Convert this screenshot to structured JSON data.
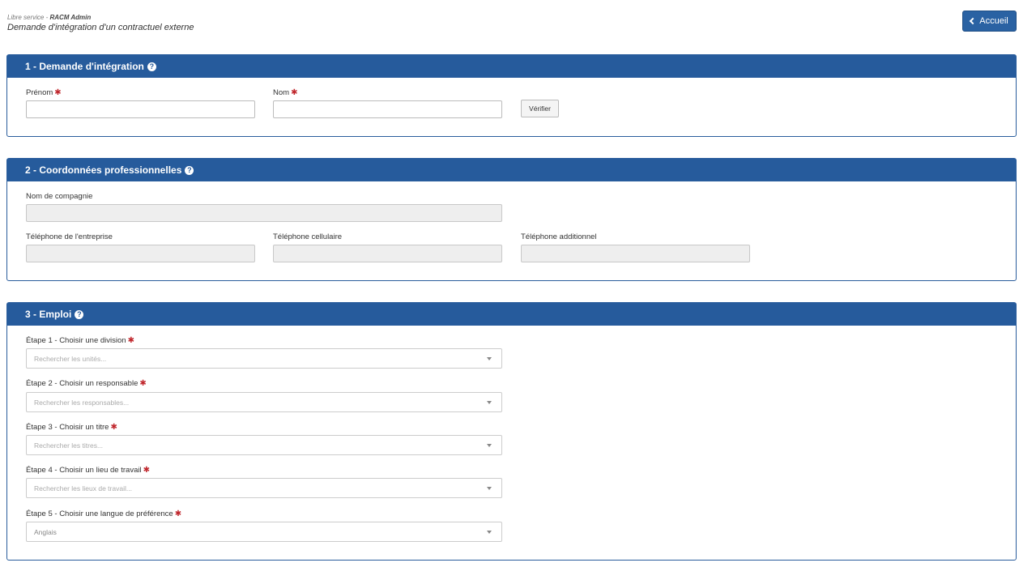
{
  "header": {
    "breadcrumb_prefix": "Libre service - ",
    "breadcrumb_app": "RACM Admin",
    "title": "Demande d'intégration d'un contractuel externe",
    "home_button": "Accueil"
  },
  "section1": {
    "title": "1 - Demande d'intégration",
    "first_name_label": "Prénom",
    "last_name_label": "Nom",
    "first_name_value": "",
    "last_name_value": "",
    "verify_button": "Vérifier"
  },
  "section2": {
    "title": "2 - Coordonnées professionnelles",
    "company_label": "Nom de compagnie",
    "company_phone_label": "Téléphone de l'entreprise",
    "cell_phone_label": "Téléphone cellulaire",
    "additional_phone_label": "Téléphone additionnel"
  },
  "section3": {
    "title": "3 - Emploi",
    "steps": [
      {
        "label": "Étape 1 - Choisir une division",
        "placeholder": "Rechercher les unités..."
      },
      {
        "label": "Étape 2 - Choisir un responsable",
        "placeholder": "Rechercher les responsables..."
      },
      {
        "label": "Étape 3 - Choisir un titre",
        "placeholder": "Rechercher les titres..."
      },
      {
        "label": "Étape 4 - Choisir un lieu de travail",
        "placeholder": "Rechercher les lieux de travail..."
      },
      {
        "label": "Étape 5 - Choisir une langue de préférence",
        "value": "Anglais"
      }
    ]
  },
  "required_marker": "✱",
  "help_glyph": "?",
  "colors": {
    "panel_header": "#265b9c",
    "required": "#c0272d",
    "primary_button": "#2a62a3"
  }
}
